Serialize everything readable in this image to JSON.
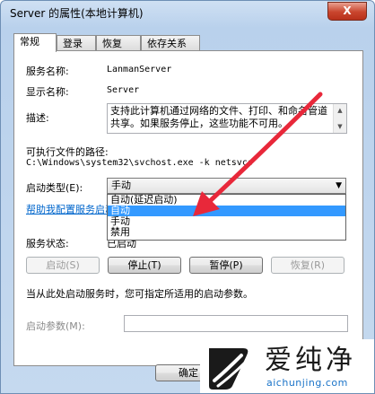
{
  "window": {
    "title": "Server 的属性(本地计算机)",
    "close_label": "X"
  },
  "tabs": [
    "常规",
    "登录",
    "恢复",
    "依存关系"
  ],
  "fields": {
    "service_name_label": "服务名称:",
    "service_name_value": "LanmanServer",
    "display_name_label": "显示名称:",
    "display_name_value": "Server",
    "description_label": "描述:",
    "description_value": "支持此计算机通过网络的文件、打印、和命名管道共享。如果服务停止，这些功能不可用。",
    "exec_path_label": "可执行文件的路径:",
    "exec_path_value": "C:\\Windows\\system32\\svchost.exe -k netsvcs",
    "startup_type_label": "启动类型(E):",
    "startup_type_value": "手动",
    "startup_options": [
      "自动(延迟启动)",
      "自动",
      "手动",
      "禁用"
    ],
    "help_link": "帮助我配置服务启动",
    "status_label": "服务状态:",
    "status_value": "已启动"
  },
  "buttons": {
    "start": "启动(S)",
    "stop": "停止(T)",
    "pause": "暂停(P)",
    "resume": "恢复(R)"
  },
  "hint": "当从此处启动服务时，您可指定所适用的启动参数。",
  "params_label": "启动参数(M):",
  "ok_label": "确定",
  "colors": {
    "arrow": "#e8283a",
    "selection": "#3399ff"
  },
  "watermark": {
    "name": "爱纯净",
    "url": "aichunjing.com"
  }
}
